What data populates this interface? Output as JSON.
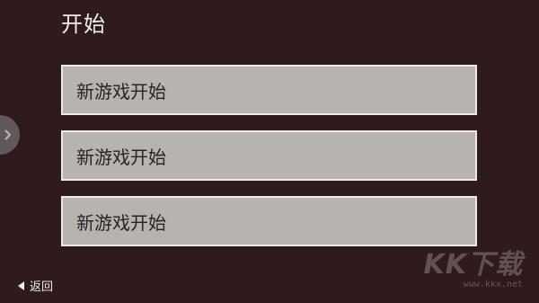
{
  "header": {
    "title": "开始"
  },
  "slots": [
    {
      "label": "新游戏开始"
    },
    {
      "label": "新游戏开始"
    },
    {
      "label": "新游戏开始"
    }
  ],
  "side_handle": {
    "icon": "chevron-icon"
  },
  "footer": {
    "back_label": "返回"
  },
  "watermark": {
    "logo": "KK下载",
    "url": "www.kkx.net"
  },
  "colors": {
    "background": "#2f1b1d",
    "slot_fill": "#b7b3af",
    "slot_border": "#efe9e6",
    "text_light": "#f4eeee",
    "text_dark": "#2a2325"
  }
}
